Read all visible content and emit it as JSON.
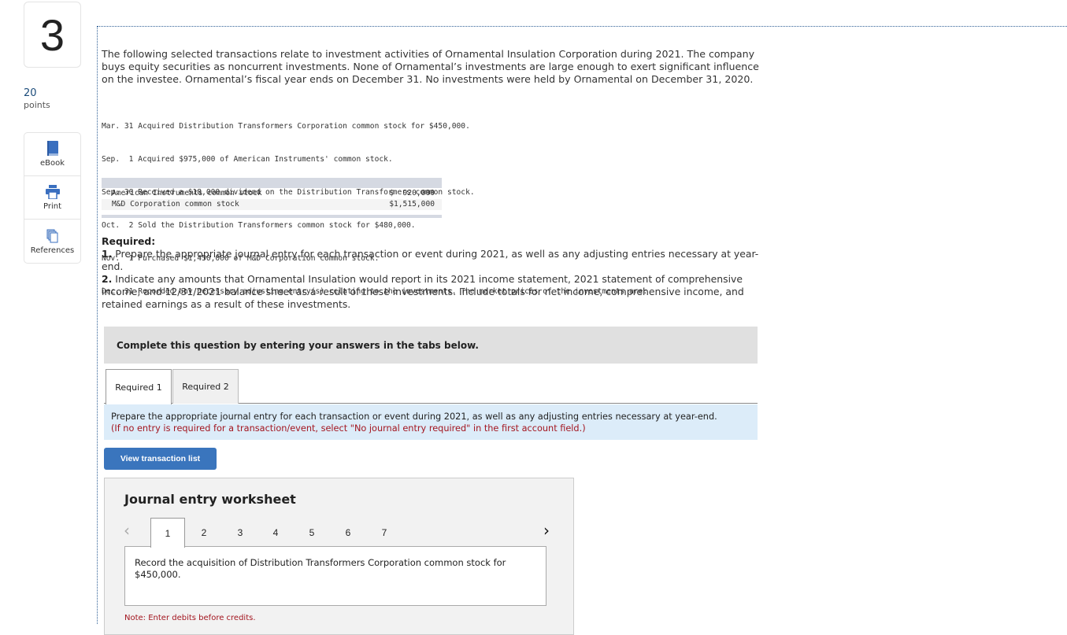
{
  "question": {
    "number": "3",
    "points_value": "20",
    "points_label": "points"
  },
  "tools": [
    {
      "label": "eBook",
      "icon": "book-icon"
    },
    {
      "label": "Print",
      "icon": "printer-icon"
    },
    {
      "label": "References",
      "icon": "references-icon"
    }
  ],
  "intro": "The following selected transactions relate to investment activities of Ornamental Insulation Corporation during 2021. The company buys equity securities as noncurrent investments. None of Ornamental’s investments are large enough to exert significant influence on the investee. Ornamental’s fiscal year ends on December 31. No investments were held by Ornamental on December 31, 2020.",
  "transactions": [
    {
      "date": "Mar. 31",
      "text": "Acquired Distribution Transformers Corporation common stock for $450,000."
    },
    {
      "date": "Sep.  1",
      "text": "Acquired $975,000 of American Instruments' common stock."
    },
    {
      "date": "Sep. 30",
      "text": "Received a $18,000 dividend on the Distribution Transformers common stock."
    },
    {
      "date": "Oct.  2",
      "text": "Sold the Distribution Transformers common stock for $480,000."
    },
    {
      "date": "Nov.  1",
      "text": "Purchased $1,450,000 of M&D Corporation common stock."
    },
    {
      "date": "Dec. 31",
      "text": "Recorded any necessary adjusting entry(s) relating to the investments. The market prices of the investments are:"
    }
  ],
  "market_prices": [
    {
      "name": "American Instruments common stock",
      "value": "$  920,000"
    },
    {
      "name": "M&D Corporation common stock",
      "value": "$1,515,000"
    }
  ],
  "required": {
    "heading": "Required:",
    "items": [
      {
        "num": "1.",
        "text": "Prepare the appropriate journal entry for each transaction or event during 2021, as well as any adjusting entries necessary at year-end."
      },
      {
        "num": "2.",
        "text": "Indicate any amounts that Ornamental Insulation would report in its 2021 income statement, 2021 statement of comprehensive income, and 12/31/2021 balance sheet as a result of these investments. Include totals for net income, comprehensive income, and retained earnings as a result of these investments."
      }
    ]
  },
  "complete_banner": "Complete this question by entering your answers in the tabs below.",
  "tabs": [
    {
      "label": "Required 1",
      "active": true
    },
    {
      "label": "Required 2",
      "active": false
    }
  ],
  "instruction": {
    "main": "Prepare the appropriate journal entry for each transaction or event during 2021, as well as any adjusting entries necessary at year-end.",
    "note": "(If no entry is required for a transaction/event, select \"No journal entry required\" in the first account field.)"
  },
  "view_transaction_button": "View transaction list",
  "worksheet": {
    "title": "Journal entry worksheet",
    "prev_icon": "‹",
    "next_icon": "›",
    "pages": [
      "1",
      "2",
      "3",
      "4",
      "5",
      "6",
      "7"
    ],
    "active_page": "1",
    "description": "Record the acquisition of Distribution Transformers Corporation common stock for $450,000.",
    "note": "Note: Enter debits before credits."
  },
  "colors": {
    "accent_blue": "#3a75bd",
    "info_bg": "#dcecf9",
    "note_red": "#a3151f"
  }
}
